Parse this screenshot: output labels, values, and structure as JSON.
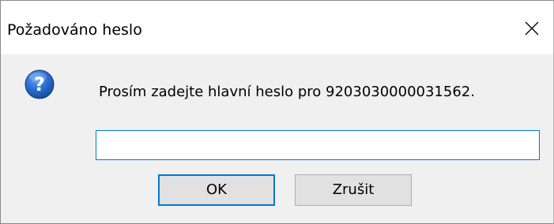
{
  "window": {
    "title": "Požadováno heslo"
  },
  "dialog": {
    "icon": "question-icon",
    "message": "Prosím zadejte hlavní heslo pro 9203030000031562.",
    "password": {
      "value": "",
      "placeholder": ""
    },
    "buttons": {
      "ok_label": "OK",
      "cancel_label": "Zrušit"
    }
  },
  "colors": {
    "accent": "#0078d7",
    "icon_blue": "#1e5fb8",
    "dialog_bg": "#f0f0f0",
    "button_bg": "#e1e1e1"
  }
}
